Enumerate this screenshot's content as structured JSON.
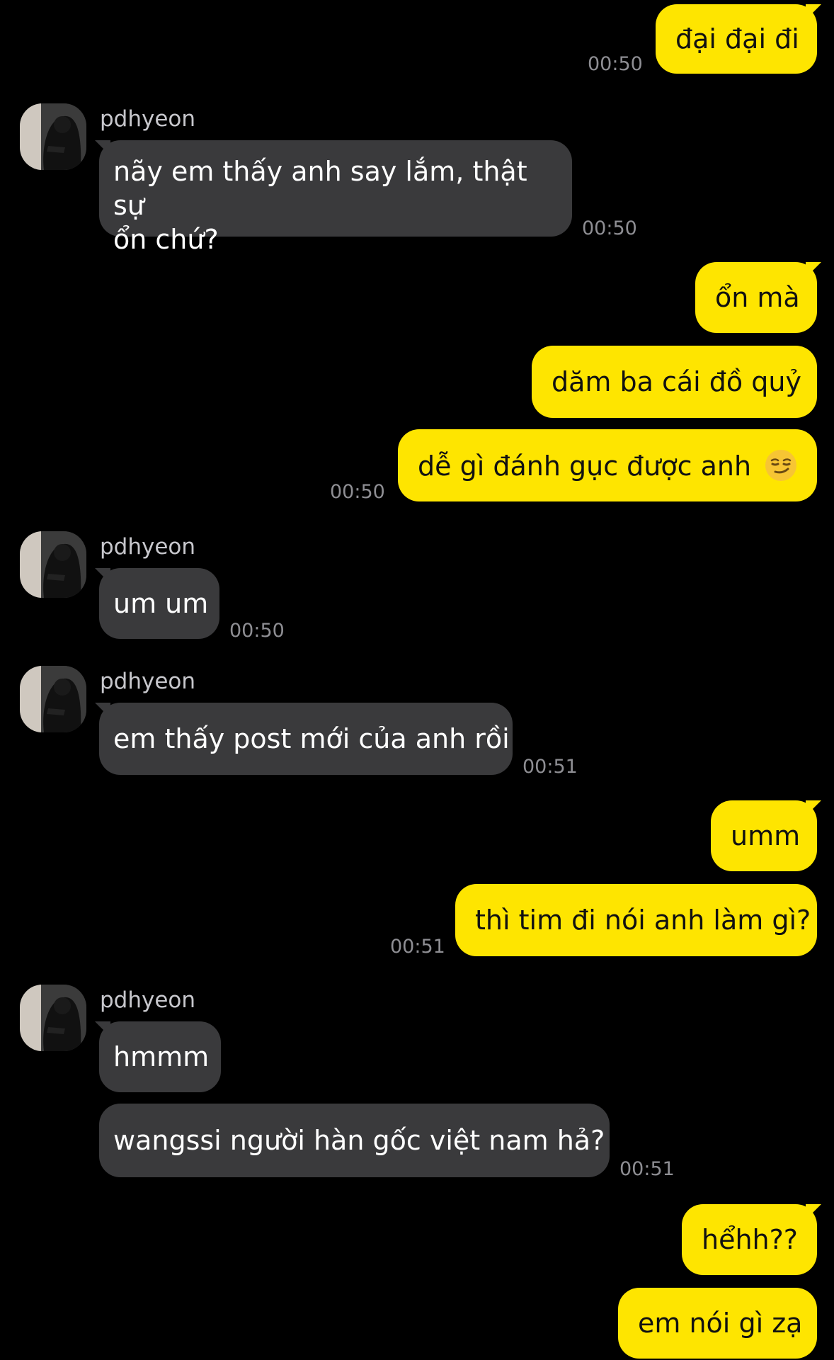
{
  "chat": {
    "contact_name": "pdhyeon",
    "messages": [
      {
        "id": "m1",
        "from": "me",
        "text": "đại đại đi",
        "time": "00:50"
      },
      {
        "id": "m2",
        "from": "them",
        "text_line1": "nãy em thấy anh say lắm, thật sự",
        "text_line2": "ổn chứ?",
        "time": "00:50"
      },
      {
        "id": "m3",
        "from": "me",
        "text": "ổn mà"
      },
      {
        "id": "m4",
        "from": "me",
        "text": "dăm ba cái đồ quỷ"
      },
      {
        "id": "m5",
        "from": "me",
        "text": "dễ gì đánh gục được anh",
        "emoji": "smirking-face-emoji",
        "time": "00:50"
      },
      {
        "id": "m6",
        "from": "them",
        "text": "um um",
        "time": "00:50"
      },
      {
        "id": "m7",
        "from": "them",
        "text": "em thấy post mới của anh rồi",
        "time": "00:51"
      },
      {
        "id": "m8",
        "from": "me",
        "text": "umm"
      },
      {
        "id": "m9",
        "from": "me",
        "text": "thì tim đi nói anh làm gì?",
        "time": "00:51"
      },
      {
        "id": "m10",
        "from": "them",
        "text": "hmmm"
      },
      {
        "id": "m11",
        "from": "them",
        "text": "wangssi người hàn gốc việt nam hả?",
        "time": "00:51"
      },
      {
        "id": "m12",
        "from": "me",
        "text": "hểhh??"
      },
      {
        "id": "m13",
        "from": "me",
        "text": "em nói gì zạ"
      }
    ]
  },
  "colors": {
    "background": "#000000",
    "my_bubble": "#fee500",
    "their_bubble": "#3a3a3c",
    "timestamp": "#8e8e93",
    "name": "#c7c7cc"
  },
  "icons": {
    "avatar": "profile-photo-avatar",
    "emoji": "smirking-face-emoji"
  }
}
